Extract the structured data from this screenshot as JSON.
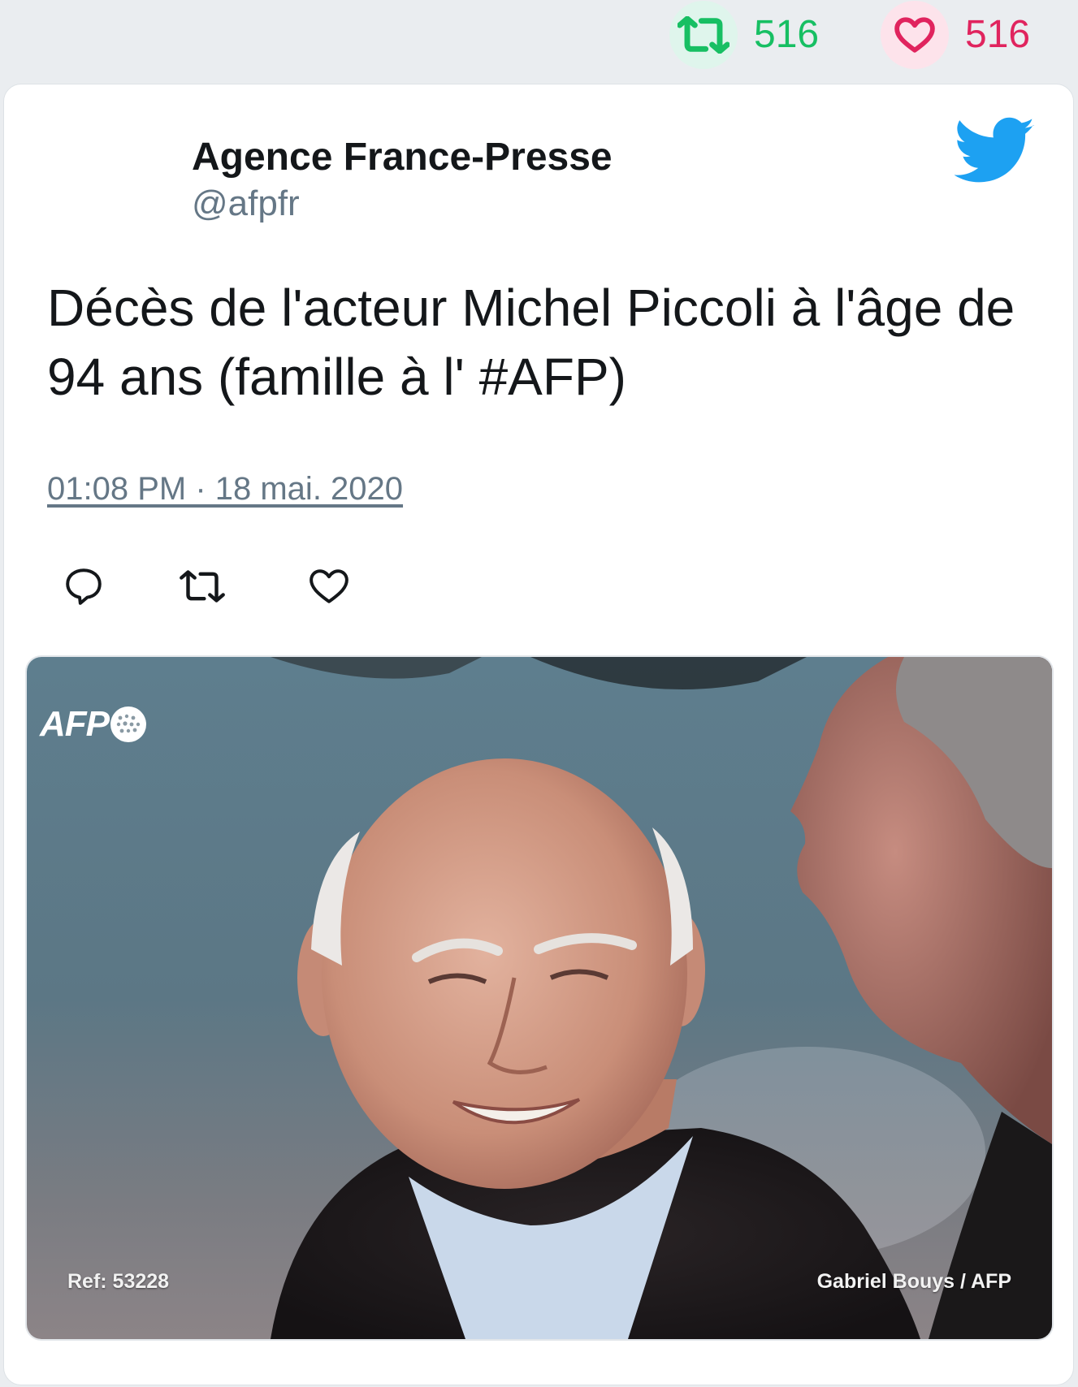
{
  "stats": {
    "retweet_count": "516",
    "like_count": "516",
    "retweet_color": "#17bf63",
    "like_color": "#e0245e"
  },
  "tweet": {
    "display_name": "Agence France-Presse",
    "handle": "@afpfr",
    "text": "Décès de l'acteur Michel Piccoli à l'âge de 94 ans (famille à l' #AFP)",
    "timestamp": "01:08 PM · 18 mai. 2020"
  },
  "actions": {
    "reply_icon": "reply-icon",
    "retweet_icon": "retweet-icon",
    "like_icon": "heart-icon"
  },
  "media": {
    "logo_text": "AFP",
    "ref": "Ref: 53228",
    "credit": "Gabriel Bouys / AFP"
  },
  "colors": {
    "twitter_blue": "#1da1f2",
    "text": "#14171a",
    "muted": "#657786",
    "background": "#eaedf0"
  }
}
